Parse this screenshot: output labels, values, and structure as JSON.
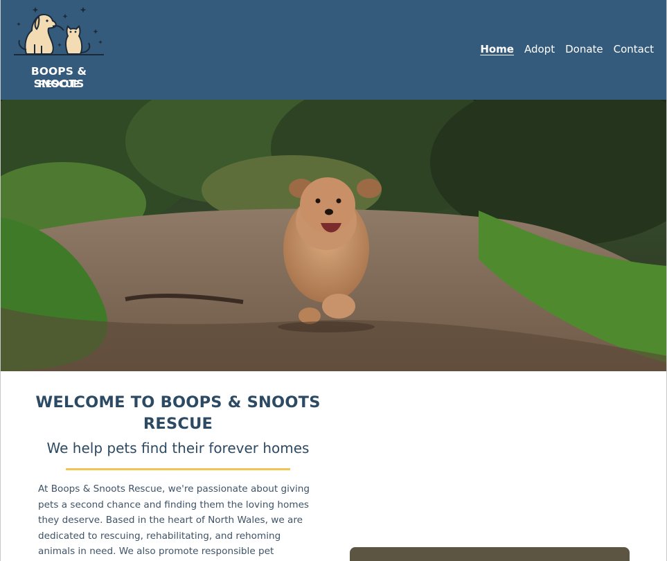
{
  "header": {
    "logo_line1": "BOOPS & SNOOTS",
    "logo_line2": "RESCUE"
  },
  "nav": [
    {
      "label": "Home",
      "active": true
    },
    {
      "label": "Adopt",
      "active": false
    },
    {
      "label": "Donate",
      "active": false
    },
    {
      "label": "Contact",
      "active": false
    }
  ],
  "welcome": {
    "title": "WELCOME TO BOOPS & SNOOTS RESCUE",
    "subtitle": "We help pets find their forever homes",
    "intro": "At Boops & Snoots Rescue, we're passionate about giving pets a second chance and finding them the loving homes they deserve. Based in the heart of North Wales, we are dedicated to rescuing, rehabilitating, and rehoming animals in need. We also promote responsible pet"
  },
  "colors": {
    "header_bg": "#345a7c",
    "heading_text": "#2c4a63",
    "accent_rule": "#f1c550"
  },
  "icons": {
    "logo": "dog-and-cat-logo-icon",
    "sparkles": "sparkle-icon"
  }
}
